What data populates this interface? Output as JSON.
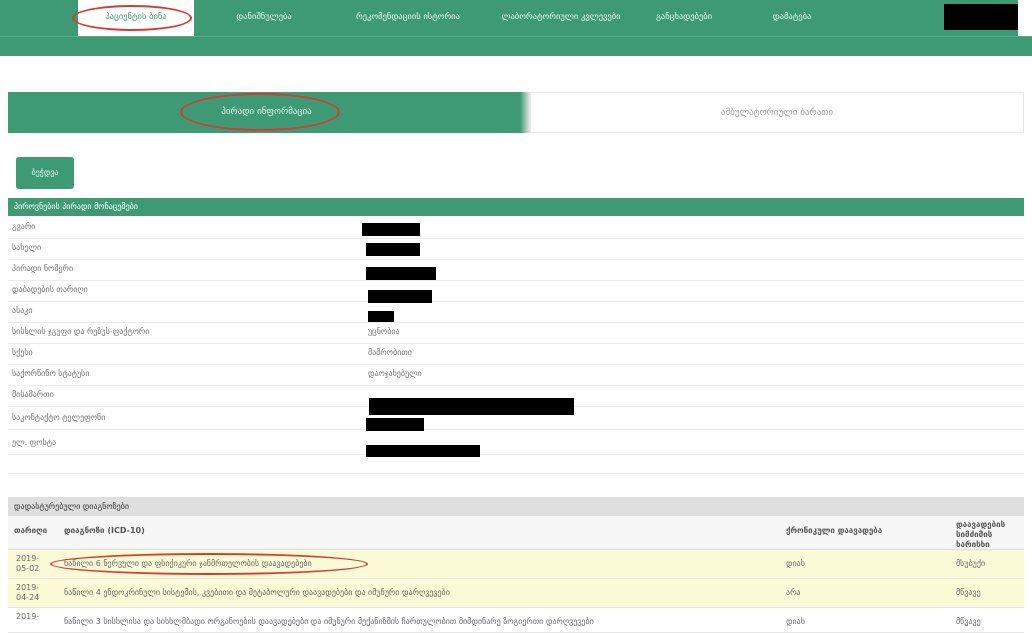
{
  "topnav": {
    "tabs": [
      {
        "label": "პაციენტის ბინა",
        "active": true
      },
      {
        "label": "დანიშნულება",
        "active": false
      },
      {
        "label": "რეკომენდაციის ისტორია",
        "active": false
      },
      {
        "label": "ლაბორატორიული კვლევები",
        "active": false
      },
      {
        "label": "განცხადებები",
        "active": false
      },
      {
        "label": "დამატება",
        "active": false
      }
    ]
  },
  "big_tabs": {
    "left": "პირადი ინფორმაცია",
    "right": "ამბულატორიული ბარათი"
  },
  "action_button": "ბეჭდვა",
  "personal_info": {
    "title": "პიროვნების პირადი მონაცემები",
    "rows": [
      {
        "label": "გვარი",
        "value": ""
      },
      {
        "label": "სახელი",
        "value": ""
      },
      {
        "label": "პირადი ნომერი",
        "value": ""
      },
      {
        "label": "დაბადების თარიღი",
        "value": ""
      },
      {
        "label": "ასაკი",
        "value": ""
      },
      {
        "label": "სისხლის ჯგუფი და რეზუს-ფაქტორი",
        "value": "უცნობია"
      },
      {
        "label": "სქესი",
        "value": "მამრობითი"
      },
      {
        "label": "საქორწინო სტატუსი",
        "value": "დაოჯახებული"
      },
      {
        "label": "მისამართი",
        "value": ""
      },
      {
        "label": "საკონტაქტო ტელეფონი",
        "value": ""
      },
      {
        "label": "ელ. ფოსტა",
        "value": ""
      }
    ]
  },
  "diagnoses": {
    "title": "დადასტურებული დიაგნოზები",
    "columns": [
      "თარიღი",
      "დიაგნოზი (ICD-10)",
      "ქრონიკული დაავადება",
      "დაავადების სიმძიმის ხარისხი"
    ],
    "rows": [
      {
        "date": "2019-05-02",
        "diagnosis": "ნაწილი 6 ნერვული და ფსიქიკური ჯანმრთელობის დაავადებები",
        "chronic": "დიახ",
        "severity": "მსუბუქი",
        "highlight": true
      },
      {
        "date": "2019-04-24",
        "diagnosis": "ნაწილი 4 ენდოკრინული სისტემის, კვებითი და მეტაბოლური დაავადებები და იმუნური დარღვევები",
        "chronic": "არა",
        "severity": "მწვავე",
        "highlight": false
      },
      {
        "date": "2019-",
        "diagnosis": "ნაწილი 3 სისხლისა და სისხლმბადი ორგანოების დაავადებები და იმუნური მექანიზმის ჩართულობით მიმდინარე ზოგიერთი დარღვევები",
        "chronic": "დიახ",
        "severity": "მწვავე",
        "highlight": false
      }
    ]
  }
}
